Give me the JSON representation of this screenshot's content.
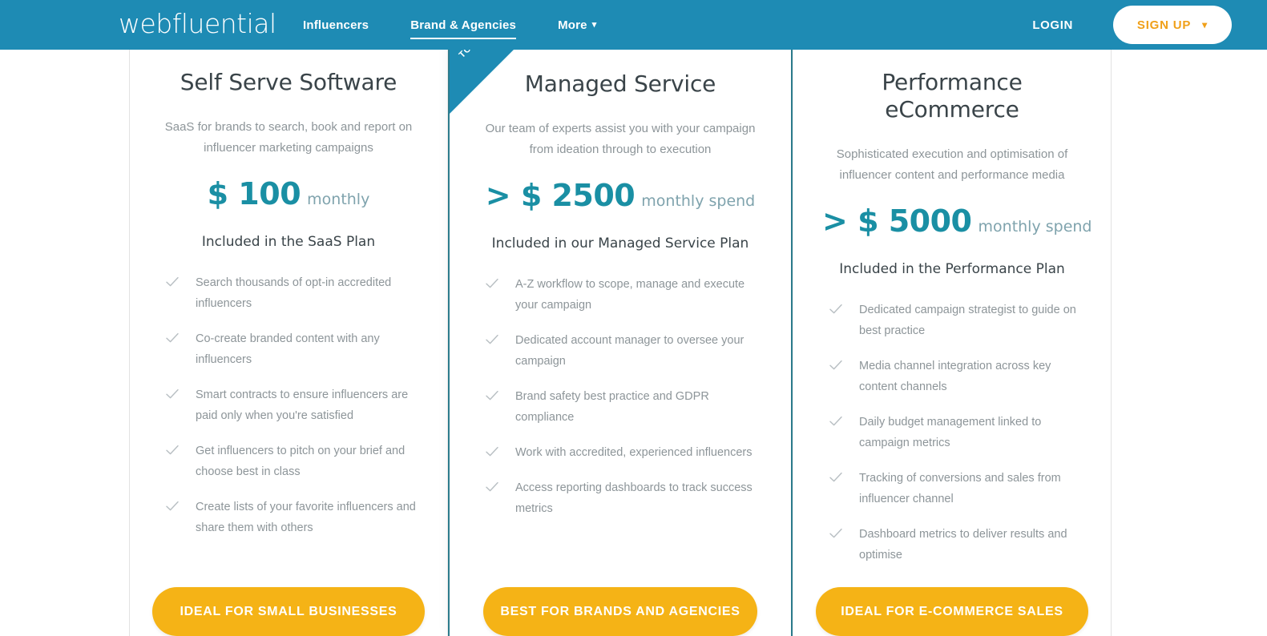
{
  "header": {
    "brand": "webfluential",
    "nav_items": [
      {
        "label": "Influencers",
        "active": false,
        "has_caret": false
      },
      {
        "label": "Brand & Agencies",
        "active": true,
        "has_caret": false
      },
      {
        "label": "More",
        "active": false,
        "has_caret": true
      }
    ],
    "login_label": "LOGIN",
    "signup_label": "SIGN UP",
    "caret_glyph": "⌄",
    "background_color": "#1e8bb4",
    "signup_text_color": "#f0a019"
  },
  "colors": {
    "teal": "#1e8bb4",
    "price_teal": "#1a8fa4",
    "amber": "#f5b316",
    "body_text": "#8d9599",
    "heading_text": "#3a4449"
  },
  "cards": [
    {
      "title": "Self Serve Software",
      "description": "SaaS for brands to search, book and report on influencer marketing campaigns",
      "price": "$ 100",
      "price_unit": "monthly",
      "plan_label": "Included in the SaaS Plan",
      "ribbon": null,
      "features": [
        "Search thousands of opt-in accredited influencers",
        "Co-create branded content with any influencers",
        "Smart contracts to ensure influencers are paid only when you're satisfied",
        "Get influencers to pitch on your brief and choose best in class",
        "Create lists of your favorite influencers and share them with others"
      ],
      "cta_label": "IDEAL FOR SMALL BUSINESSES"
    },
    {
      "title": "Managed Service",
      "description": "Our team of experts assist you with your campaign from ideation through to execution",
      "price": "> $ 2500",
      "price_unit": "monthly spend",
      "plan_label": "Included in our Managed Service Plan",
      "ribbon": "TOP RATED",
      "features": [
        "A-Z workflow to scope, manage and execute your campaign",
        "Dedicated account manager to oversee your campaign",
        "Brand safety best practice and GDPR compliance",
        "Work with accredited, experienced influencers",
        "Access reporting dashboards to track success metrics"
      ],
      "cta_label": "BEST FOR BRANDS AND AGENCIES"
    },
    {
      "title": "Performance eCommerce",
      "description": "Sophisticated execution and optimisation of influencer content and performance media",
      "price": "> $ 5000",
      "price_unit": "monthly spend",
      "plan_label": "Included in the Performance Plan",
      "ribbon": null,
      "features": [
        "Dedicated campaign strategist to guide on best practice",
        "Media channel integration across key content channels",
        "Daily budget management linked to campaign metrics",
        "Tracking of conversions and sales from influencer channel",
        "Dashboard metrics to deliver results and optimise"
      ],
      "cta_label": "IDEAL FOR E-COMMERCE SALES"
    }
  ]
}
